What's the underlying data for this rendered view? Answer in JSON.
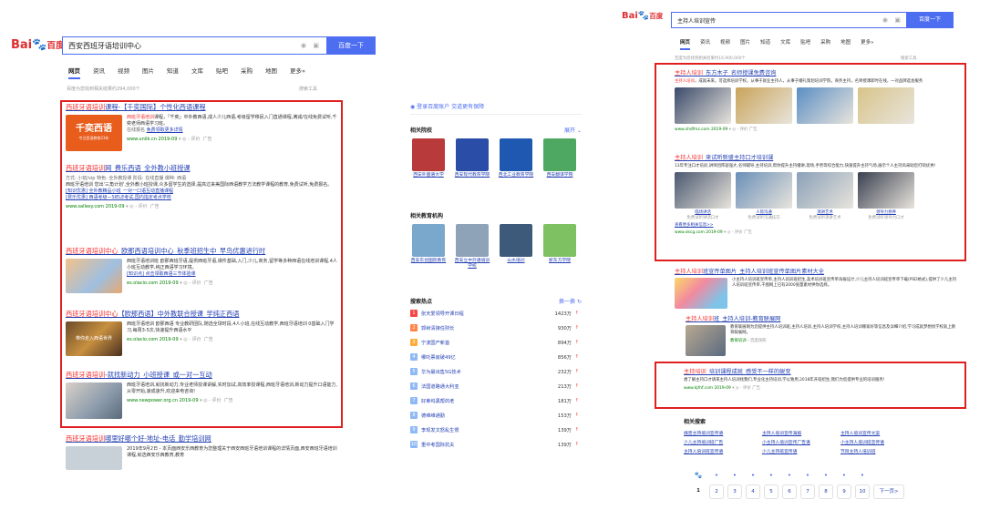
{
  "left": {
    "logo": {
      "bai": "Bai",
      "paw": "🐾",
      "du": "百度"
    },
    "search": {
      "query": "西安西班牙语培训中心",
      "button": "百度一下",
      "mic_icon": "mic-icon",
      "camera_icon": "camera-icon"
    },
    "tabs": [
      "网页",
      "资讯",
      "视频",
      "图片",
      "知道",
      "文库",
      "贴吧",
      "采购",
      "地图",
      "更多»"
    ],
    "meta": "百度为您找到相关结果约294,000个",
    "tools": "搜索工具",
    "results": [
      {
        "title_hl": "西班牙语培训",
        "title_rest": "课程-【千奕国际】个性化西语课程",
        "thumb_text": "千奕西语",
        "thumb_sub": "专注西语教育23年",
        "desc_hl": "西班牙语培训",
        "desc": "课程，「千奕」中外教西语,成人少儿西语,考级留学移民入门直通课程,满减/在线免费试听,千奕老师西语学习班。",
        "sub1": "在线报名",
        "sub2": "免费领取更多详情",
        "url": "www.uniik.cn",
        "date": "2019-09",
        "eval": "评价",
        "ad": "广告"
      },
      {
        "title_hl": "西班牙语培训",
        "title_rest": "网_费乐西语_全外教小班授课",
        "desc_lines": [
          "方式: 小班/vip    特色: 全外教授课    阶段: 在线直播    课种: 西语",
          "西班牙语培训 您出'三角计划',全外教小班授课,众多留学生的选择,提高过来美国际西语教学方法教学课程的教育,免费试听,免费报名。",
          "[知识优惠] 全外教精品小班_一对一口语互动直播课程",
          "[费乐优惠] 西语考级—SIELE考试,国内指定考点学校"
        ],
        "url": "www.sallesy.com",
        "date": "2019-09",
        "eval": "评价",
        "ad": "广告"
      },
      {
        "title_hl": "西班牙语培训中心",
        "title_rest": "_欧那西语培训中心_秋季班招生中_早鸟优惠进行时",
        "desc": "西班牙语培训班 欧那西班牙语,提供西班牙语,课件基础,入门,少儿,商务,留学等多种西语在线培训课程,4人小班互动教学,纯正西语学习环境。",
        "sub": "[知识点] 点击领取西语三节体验课",
        "url": "es.olacio.com",
        "date": "2019-09",
        "eval": "评价",
        "ad": "广告"
      },
      {
        "title_hl": "西班牙语培训中心",
        "title_rest": "【欧那西语】中外教联合授课_学纯正西语",
        "thumb_text": "带你走入西语世界",
        "desc": "西班牙语培训 欧那西语 专业教研团队,随选全球时段,4人小班,在线互动教学,西班牙语培训 0基础入门学习,每周3-5次,快速提升西语水平",
        "url": "es.olacio.com",
        "date": "2019-09",
        "eval": "评价",
        "ad": "广告"
      },
      {
        "title_hl": "西班牙语培训",
        "title_rest": "-就找新动力_小班授课_或一对一互动",
        "desc": "西班牙语培训,就找新动力,专业老师授课讲解,实时加试,高效率授课程,西班牙语培训,新动力提升口语能力,从零开始,速成速升,欢迎来电咨询!",
        "url": "www.newpower.org.cn",
        "date": "2019-09",
        "eval": "评价",
        "ad": "广告"
      },
      {
        "title_hl": "西班牙语培训",
        "title_rest": "哪里好哪个好-地址-电话_勤学培训网",
        "desc": "2019年9月2日 - 本页面西安乐西教育为您整理关于西安西班牙语培训课程的详情页面,西安西班牙语培训课程,就选西安乐西教育,教育",
        "url": "",
        "date": "",
        "eval": "",
        "ad": ""
      }
    ],
    "sidebar": {
      "login": "登录百度账户  交道更有保障",
      "related_title": "相关院校",
      "related_more": "展开",
      "related": [
        {
          "label": "西安外国语大学",
          "color": "#b83a3a"
        },
        {
          "label": "西安现代教育学院",
          "color": "#2a4ea8"
        },
        {
          "label": "西北工业教育学院",
          "color": "#1e58b0"
        },
        {
          "label": "西安翻译学院",
          "color": "#4fa862"
        }
      ],
      "orgs_title": "相关教育机构",
      "orgs": [
        {
          "label": "西安东创国际教育",
          "color": "#7aa8cc"
        },
        {
          "label": "西安立中外语培训学校",
          "color": "#8fa3b8"
        },
        {
          "label": "山水培训",
          "color": "#3e5a7a"
        },
        {
          "label": "新东方学院",
          "color": "#7dc163"
        }
      ],
      "hot_title": "搜索热点",
      "hot_refresh": "换一换",
      "hot": [
        {
          "rank": "1",
          "text": "张天爱领导开课日程",
          "count": "1423万",
          "color": "#f54545"
        },
        {
          "rank": "2",
          "text": "郭树清接任财长",
          "count": "930万",
          "color": "#ff8547"
        },
        {
          "rank": "3",
          "text": "宁波国产新首",
          "count": "894万",
          "color": "#ffac38"
        },
        {
          "rank": "4",
          "text": "哪吒票房破49亿",
          "count": "856万",
          "color": "#8eb9f5"
        },
        {
          "rank": "5",
          "text": "华为最出售5G技术",
          "count": "232万",
          "color": "#8eb9f5"
        },
        {
          "rank": "6",
          "text": "法国道路通大利亚",
          "count": "213万",
          "color": "#8eb9f5"
        },
        {
          "rank": "7",
          "text": "好莱坞黑帮的老",
          "count": "181万",
          "color": "#8eb9f5"
        },
        {
          "rank": "8",
          "text": "德维维通勤",
          "count": "153万",
          "color": "#8eb9f5"
        },
        {
          "rank": "9",
          "text": "李现发文怒乱生恨",
          "count": "139万",
          "color": "#8eb9f5"
        },
        {
          "rank": "10",
          "text": "重中考国际抗夫",
          "count": "139万",
          "color": "#8eb9f5"
        }
      ]
    }
  },
  "right": {
    "logo": {
      "bai": "Bai",
      "paw": "🐾",
      "du": "百度"
    },
    "search": {
      "query": "主持人培训宣传",
      "button": "百度一下"
    },
    "tabs": [
      "网页",
      "资讯",
      "视频",
      "图片",
      "知道",
      "文库",
      "贴吧",
      "采购",
      "地图",
      "更多»"
    ],
    "meta": "百度为您找到相关结果约16,900,000个",
    "tools": "搜索工具",
    "results": [
      {
        "title_hl": "主持人培训",
        "title_rest": "_东方木子_名师授课免费咨询",
        "desc_hl": "主持人培训",
        "desc": "，成就未来，可选择培训学校，从事于就业主持人，从事于婚礼策划培训学院，商务主持，名师授课即时在线，一对品牌选会服务",
        "url": "www.shdfmz.com",
        "date": "2019-09",
        "eval": "评价",
        "ad": "广告",
        "img_colors": [
          "#3a4a6a",
          "#c9a45a",
          "#5b8ec4",
          "#d8c48a"
        ]
      },
      {
        "title_hl": "主持人培训",
        "title_rest": "_来试听新盛主持口才培训课",
        "desc": "13年专注口才培训,讲师团阵容强大,名师辅导,主持培训,帮你提升主持播讲,现场,手势等综合能力,快速提升主持气场,展示个人主持风采助您打响优秀!",
        "captions": [
          {
            "c1": "临场讲话",
            "c2": "免费试听讲话口才"
          },
          {
            "c1": "人际沟通",
            "c2": "免费试听沟通技巧"
          },
          {
            "c1": "演讲艺术",
            "c2": "免费试听演讲艺术"
          },
          {
            "c1": "领导力修养",
            "c2": "免费试听领导力口才"
          }
        ],
        "more": "查看更多相关信息>>",
        "url": "www.xkcg.com",
        "date": "2019-09",
        "eval": "评价",
        "ad": "广告",
        "img_colors": [
          "#4a5870",
          "#6a8fb8",
          "#8aa0b8",
          "#3a4050"
        ]
      },
      {
        "title_hl": "主持人培训",
        "title_rest": "班宣传单图片_主持人培训班宣传单图片素材大全",
        "desc": "小主持人培训班宣传单,主持人培训班招生,美术培训班宣传单海报设计,少儿主持人培训班宣传单下载(PSD格式),提供了少儿主持人培训班宣传单,千图网上已有2000张量素材供你选择。",
        "url": "",
        "date": "",
        "eval": "",
        "ad": ""
      },
      {
        "title_hl": "主持人培训",
        "title_rest": "班_主持人培训-教育联展网",
        "desc": "教育联展网为您提供主持人培训班,主持人培训,主持人培训学校,主持人培训哪家好等信息及详细介绍,学习成就梦想找学校就上教育联展网。",
        "url": "教育培训",
        "date": "百度快照",
        "eval": "",
        "ad": ""
      },
      {
        "title_hl": "主持培训",
        "title_rest": "_培训课程成就_感受不一样的蜕变",
        "desc": "想了解主持口才请来主持人培训找我们,专业化主持培训,学以致用,2018年开班招生,我们为您提供专业的培训服务!",
        "url": "www.kjthf.com",
        "date": "2019-09",
        "eval": "评价",
        "ad": "广告"
      }
    ],
    "related_title": "相关搜索",
    "related": [
      "播音主持培训宣传语",
      "主持人培训宣传海报",
      "主持人培训宣传文案",
      "少儿主持培训班广告",
      "小主持人培训宣传广告语",
      "小主持人培训班宣传语",
      "主持人培训班宣传语",
      "少儿主持班宣传语",
      "节目主持人培训班"
    ],
    "pages": [
      "1",
      "2",
      "3",
      "4",
      "5",
      "6",
      "7",
      "8",
      "9",
      "10"
    ],
    "next": "下一页>"
  }
}
